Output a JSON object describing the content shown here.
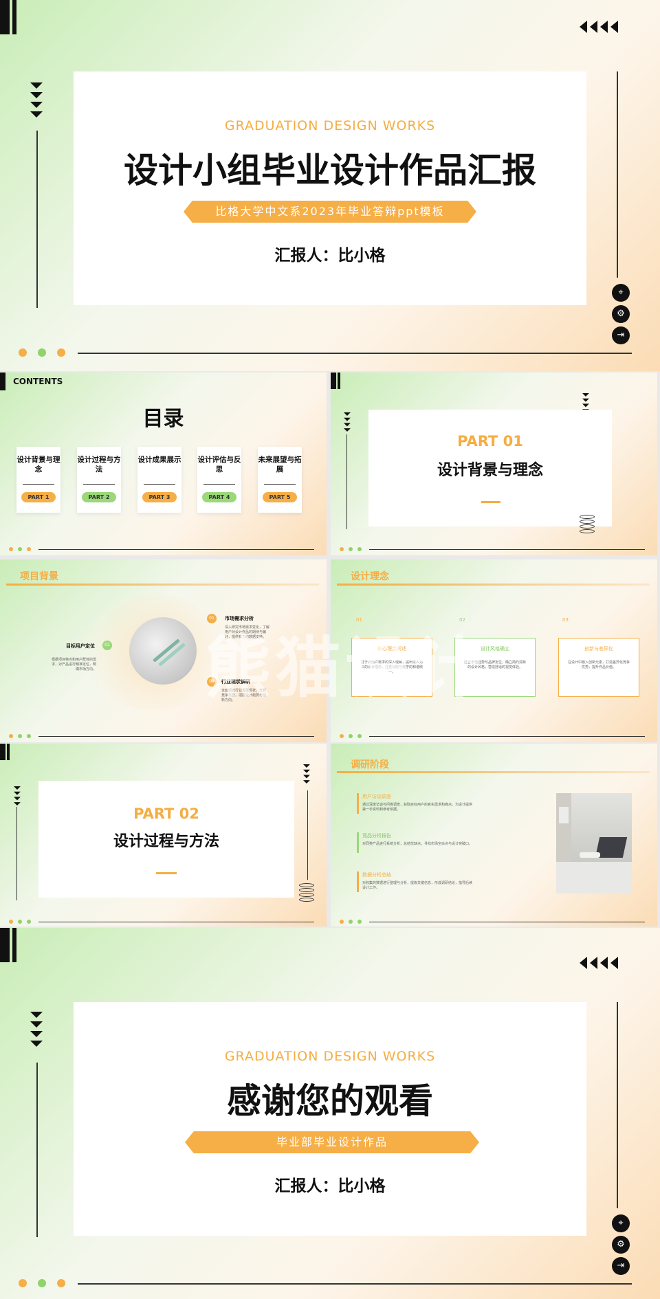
{
  "cover": {
    "eng": "GRADUATION DESIGN WORKS",
    "title": "设计小组毕业设计作品汇报",
    "ribbon": "比格大学中文系2023年毕业答辩ppt模板",
    "reporter": "汇报人：比小格"
  },
  "toc": {
    "contents": "CONTENTS",
    "title": "目录",
    "items": [
      {
        "title": "设计背景与理念",
        "part": "PART 1"
      },
      {
        "title": "设计过程与方法",
        "part": "PART 2"
      },
      {
        "title": "设计成果展示",
        "part": "PART 3"
      },
      {
        "title": "设计评估与反思",
        "part": "PART 4"
      },
      {
        "title": "未来展望与拓展",
        "part": "PART 5"
      }
    ]
  },
  "part01": {
    "label": "PART 01",
    "title": "设计背景与理念"
  },
  "project_bg": {
    "heading": "项目背景",
    "target": "目标用户定位",
    "target_no": "02",
    "target_text": "根据项目特点和用户群体的需求，对产品进行精准定位，明确市场方向。",
    "n1": "01",
    "market": "市场需求分析",
    "market_text": "深入研究市场需求变化，了解用户对设计作品的期待与偏好，提供有力的数据支持。",
    "n3": "03",
    "industry": "行业现状调研",
    "industry_text": "全面调查行业发展现状，分析竞争态势，把握设计趋势与创新方向。"
  },
  "concept": {
    "heading": "设计理念",
    "boxes": [
      {
        "no": "01",
        "title": "核心理念阐述",
        "text": "基于对用户需求的深入理解，提出以人为本的设计理念，注重功能与美学的和谐统一。"
      },
      {
        "no": "02",
        "title": "设计风格确立",
        "text": "结合市场趋势与品牌定位，确立简约清新的设计风格，营造舒适的视觉体验。"
      },
      {
        "no": "03",
        "title": "创新与差异化",
        "text": "在设计中融入创新元素，打造差异化竞争优势，提升作品价值。"
      }
    ]
  },
  "part02": {
    "label": "PART 02",
    "title": "设计过程与方法"
  },
  "research": {
    "heading": "调研阶段",
    "items": [
      {
        "title": "用户访谈调查",
        "text": "通过深度访谈与问卷调查，获取目标用户的真实需求和痛点，为设计提供第一手资料和参考依据。"
      },
      {
        "title": "竞品分析报告",
        "text": "对同类产品进行系统分析，总结优缺点，寻找市场空白点与设计突破口。"
      },
      {
        "title": "数据分析总结",
        "text": "对收集的数据进行整理与分析，提炼关键信息，形成调研结论，指导后续设计工作。"
      }
    ]
  },
  "ending": {
    "eng": "GRADUATION DESIGN WORKS",
    "title": "感谢您的观看",
    "ribbon": "毕业部毕业设计作品",
    "reporter": "汇报人：比小格"
  },
  "watermark": "熊猫设计",
  "colors": {
    "orange": "#f6ae46",
    "green": "#9ad87a",
    "dark": "#111111"
  }
}
